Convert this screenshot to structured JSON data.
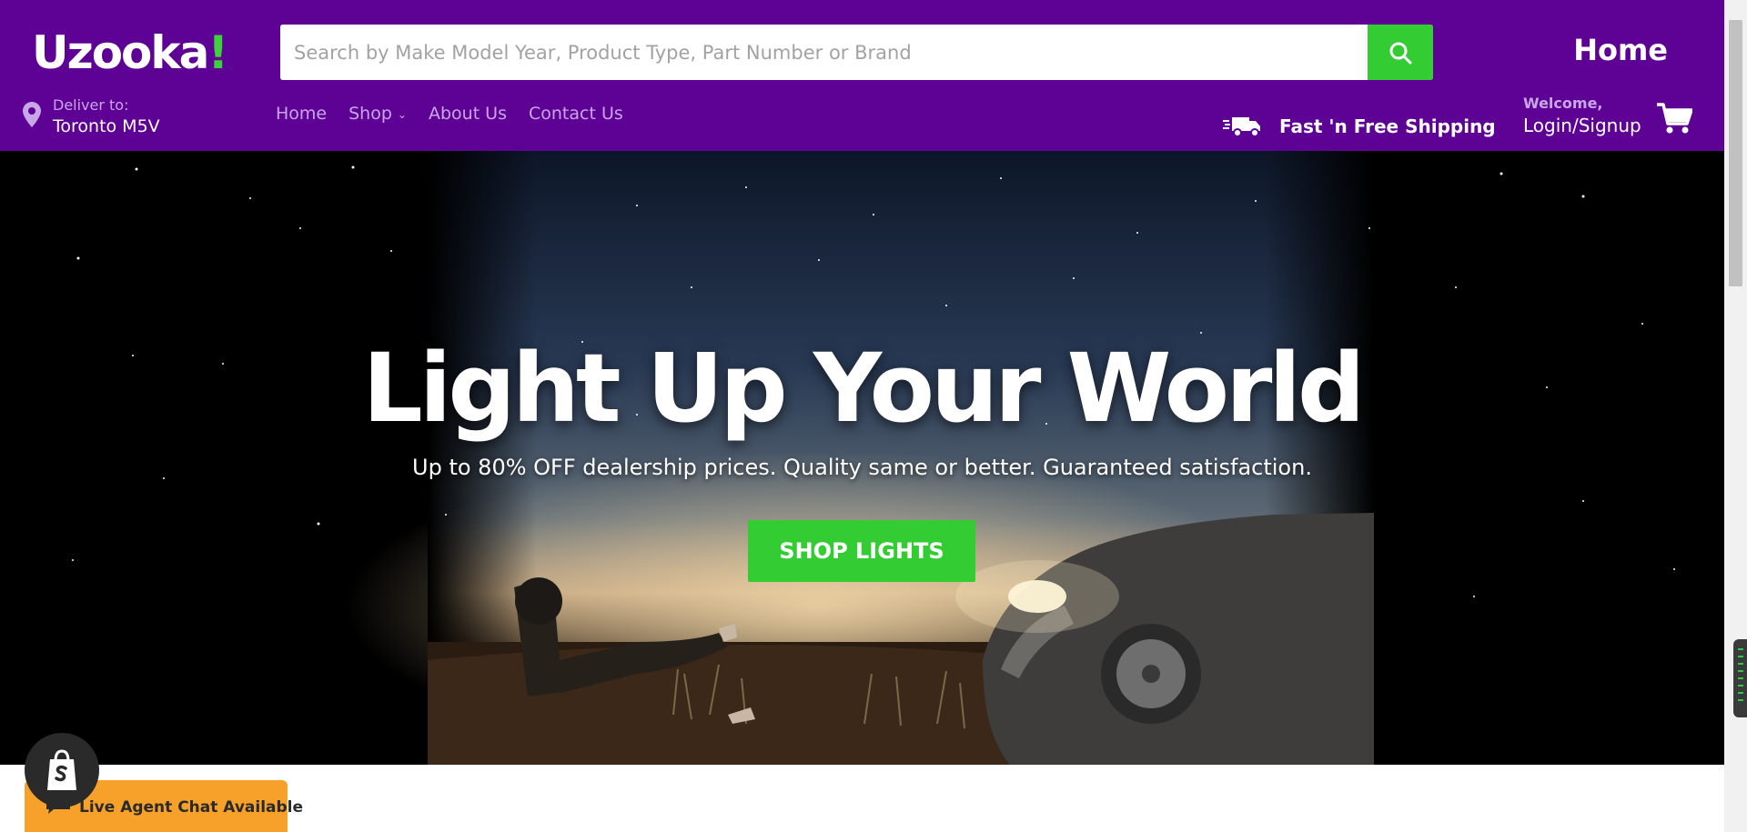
{
  "header": {
    "logo_text": "Uzooka",
    "logo_accent": "!",
    "search": {
      "placeholder": "Search by Make Model Year, Product Type, Part Number or Brand",
      "value": "",
      "icon": "search-icon"
    },
    "home_top": "Home",
    "deliver": {
      "label": "Deliver to:",
      "location": "Toronto M5V",
      "icon": "location-pin-icon"
    },
    "nav": {
      "home": "Home",
      "shop": "Shop",
      "about": "About Us",
      "contact": "Contact Us"
    },
    "shipping": {
      "label": "Fast 'n Free Shipping",
      "icon": "delivery-truck-icon"
    },
    "account": {
      "welcome": "Welcome,",
      "login": "Login/Signup"
    },
    "cart": {
      "icon": "shopping-cart-icon"
    }
  },
  "hero": {
    "title": "Light Up Your World",
    "subtitle": "Up to 80% OFF dealership prices. Quality same or better. Guaranteed satisfaction.",
    "cta": "SHOP LIGHTS"
  },
  "chat": {
    "label": "Live Agent Chat Available",
    "badge_icon": "shopify-bag-icon",
    "bubble_icon": "chat-bubble-icon"
  },
  "colors": {
    "brand_purple": "#5e0195",
    "accent_green": "#33cc33",
    "nav_lavender": "#c8a6e8",
    "chat_orange": "#f7a12b"
  }
}
